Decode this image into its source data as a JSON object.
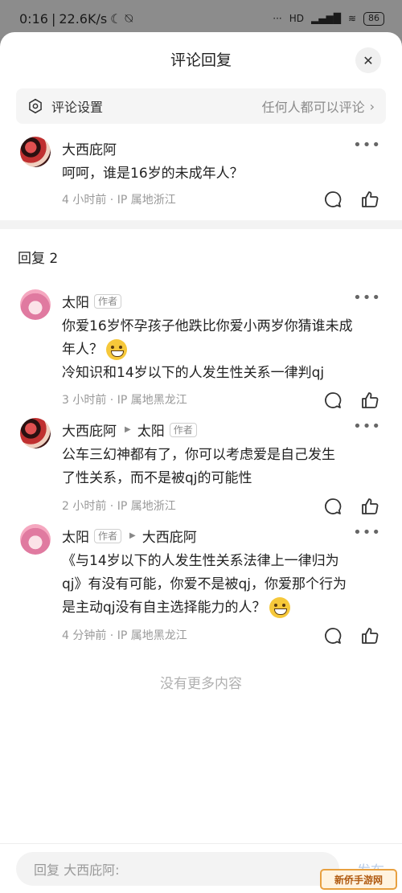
{
  "status_bar": {
    "time": "0:16",
    "speed": "22.6K/s",
    "network": "HD",
    "battery": "86"
  },
  "sheet": {
    "title": "评论回复",
    "close_icon": "close-icon"
  },
  "settings": {
    "label": "评论设置",
    "value": "任何人都可以评论",
    "icon": "gear-icon"
  },
  "root_comment": {
    "author": "大西庇阿",
    "text": "呵呵，谁是16岁的未成年人？",
    "meta": "4 小时前 · IP 属地浙江"
  },
  "replies_header": "回复 2",
  "replies": [
    {
      "author": "太阳",
      "author_tag": "作者",
      "reply_to": "",
      "lines": [
        "你爱16岁怀孕孩子他跌比你爱小两岁你猜谁未成",
        "年人？",
        "冷知识和14岁以下的人发生性关系一律判qj"
      ],
      "meta": "3 小时前 · IP 属地黑龙江"
    },
    {
      "author": "大西庇阿",
      "author_tag": "作者",
      "reply_to": "太阳",
      "lines": [
        "公车三幻神都有了，你可以考虑爱是自己发生",
        "了性关系，而不是被qj的可能性"
      ],
      "meta": "2 小时前 · IP 属地浙江"
    },
    {
      "author": "太阳",
      "author_tag": "作者",
      "reply_to": "大西庇阿",
      "lines": [
        "《与14岁以下的人发生性关系法律上一律归为",
        "qj》有没有可能，你爱不是被qj，你爱那个行为",
        "是主动qj没有自主选择能力的人？"
      ],
      "meta": "4 分钟前 · IP 属地黑龙江"
    }
  ],
  "footer": {
    "no_more": "没有更多内容",
    "reply_placeholder": "回复 大西庇阿:",
    "send_label": "发布",
    "watermark": "新侨手游网"
  }
}
